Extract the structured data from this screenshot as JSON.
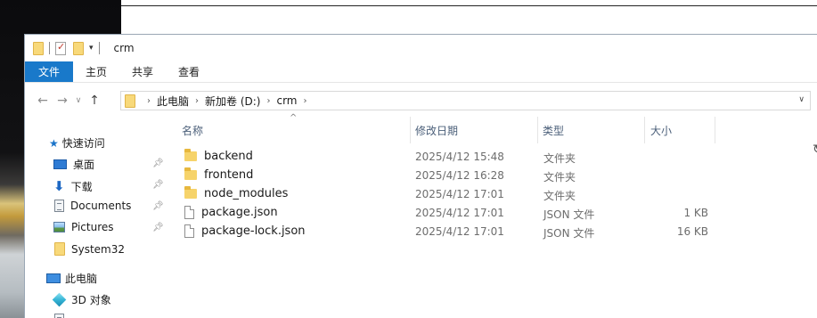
{
  "window": {
    "title": "crm"
  },
  "ribbon": {
    "tabs": [
      "文件",
      "主页",
      "共享",
      "查看"
    ]
  },
  "address": {
    "crumbs": [
      "此电脑",
      "新加卷 (D:)",
      "crm"
    ]
  },
  "nav": {
    "quick_access": "快速访问",
    "items": [
      {
        "label": "桌面",
        "icon": "desktop-icon",
        "pinned": true
      },
      {
        "label": "下载",
        "icon": "download-icon",
        "pinned": true
      },
      {
        "label": "Documents",
        "icon": "document-icon",
        "pinned": true
      },
      {
        "label": "Pictures",
        "icon": "pictures-icon",
        "pinned": true
      },
      {
        "label": "System32",
        "icon": "folder-icon",
        "pinned": false
      }
    ],
    "this_pc": "此电脑",
    "objects_3d": "3D 对象"
  },
  "columns": {
    "name": "名称",
    "date": "修改日期",
    "type": "类型",
    "size": "大小"
  },
  "files": [
    {
      "name": "backend",
      "date": "2025/4/12 15:48",
      "type": "文件夹",
      "size": "",
      "kind": "folder"
    },
    {
      "name": "frontend",
      "date": "2025/4/12 16:28",
      "type": "文件夹",
      "size": "",
      "kind": "folder"
    },
    {
      "name": "node_modules",
      "date": "2025/4/12 17:01",
      "type": "文件夹",
      "size": "",
      "kind": "folder"
    },
    {
      "name": "package.json",
      "date": "2025/4/12 17:01",
      "type": "JSON 文件",
      "size": "1 KB",
      "kind": "file"
    },
    {
      "name": "package-lock.json",
      "date": "2025/4/12 17:01",
      "type": "JSON 文件",
      "size": "16 KB",
      "kind": "file"
    }
  ],
  "colors": {
    "accent": "#1979ca",
    "folder": "#f6d36a"
  }
}
